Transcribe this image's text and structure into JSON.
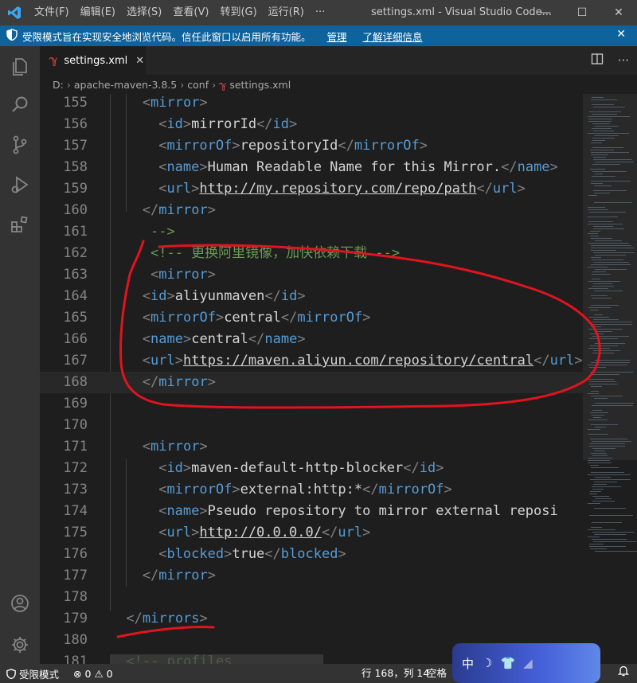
{
  "titlebar": {
    "menu": [
      "文件(F)",
      "编辑(E)",
      "选择(S)",
      "查看(V)",
      "转到(G)",
      "运行(R)",
      "···"
    ],
    "title": "settings.xml - Visual Studio Code...",
    "controls": {
      "minimize": "—",
      "maximize": "☐",
      "close": "✕"
    }
  },
  "banner": {
    "message": "受限模式旨在实现安全地浏览代码。信任此窗口以启用所有功能。",
    "manage": "管理",
    "learn_more": "了解详细信息",
    "close": "✕",
    "color": "#0e639c"
  },
  "tab": {
    "label": "settings.xml",
    "close": "✕",
    "icon": "xml-file-icon"
  },
  "breadcrumb": {
    "items": [
      "D:",
      "apache-maven-3.8.5",
      "conf",
      "settings.xml"
    ],
    "separator": "›"
  },
  "editor": {
    "lines": [
      {
        "n": "155",
        "indent": 4,
        "parts": [
          [
            "pun",
            "<"
          ],
          [
            "tag",
            "mirror"
          ],
          [
            "pun",
            ">"
          ]
        ]
      },
      {
        "n": "156",
        "indent": 6,
        "parts": [
          [
            "pun",
            "<"
          ],
          [
            "tag",
            "id"
          ],
          [
            "pun",
            ">"
          ],
          [
            "txt",
            "mirrorId"
          ],
          [
            "pun",
            "</"
          ],
          [
            "tag",
            "id"
          ],
          [
            "pun",
            ">"
          ]
        ]
      },
      {
        "n": "157",
        "indent": 6,
        "parts": [
          [
            "pun",
            "<"
          ],
          [
            "tag",
            "mirrorOf"
          ],
          [
            "pun",
            ">"
          ],
          [
            "txt",
            "repositoryId"
          ],
          [
            "pun",
            "</"
          ],
          [
            "tag",
            "mirrorOf"
          ],
          [
            "pun",
            ">"
          ]
        ]
      },
      {
        "n": "158",
        "indent": 6,
        "parts": [
          [
            "pun",
            "<"
          ],
          [
            "tag",
            "name"
          ],
          [
            "pun",
            ">"
          ],
          [
            "txt",
            "Human Readable Name for this Mirror."
          ],
          [
            "pun",
            "</"
          ],
          [
            "tag",
            "name"
          ],
          [
            "pun",
            ">"
          ]
        ]
      },
      {
        "n": "159",
        "indent": 6,
        "parts": [
          [
            "pun",
            "<"
          ],
          [
            "tag",
            "url"
          ],
          [
            "pun",
            ">"
          ],
          [
            "url",
            "http://my.repository.com/repo/path"
          ],
          [
            "pun",
            "</"
          ],
          [
            "tag",
            "url"
          ],
          [
            "pun",
            ">"
          ]
        ]
      },
      {
        "n": "160",
        "indent": 4,
        "parts": [
          [
            "pun",
            "</"
          ],
          [
            "tag",
            "mirror"
          ],
          [
            "pun",
            ">"
          ]
        ]
      },
      {
        "n": "161",
        "indent": 5,
        "parts": [
          [
            "cmt",
            "-->"
          ]
        ]
      },
      {
        "n": "162",
        "indent": 5,
        "parts": [
          [
            "cmt",
            "<!-- 更换阿里镜像，加快依赖下载 -->"
          ]
        ]
      },
      {
        "n": "163",
        "indent": 5,
        "parts": [
          [
            "pun",
            "<"
          ],
          [
            "tag",
            "mirror"
          ],
          [
            "pun",
            ">"
          ]
        ]
      },
      {
        "n": "164",
        "indent": 4,
        "parts": [
          [
            "pun",
            "<"
          ],
          [
            "tag",
            "id"
          ],
          [
            "pun",
            ">"
          ],
          [
            "txt",
            "aliyunmaven"
          ],
          [
            "pun",
            "</"
          ],
          [
            "tag",
            "id"
          ],
          [
            "pun",
            ">"
          ]
        ]
      },
      {
        "n": "165",
        "indent": 4,
        "parts": [
          [
            "pun",
            "<"
          ],
          [
            "tag",
            "mirrorOf"
          ],
          [
            "pun",
            ">"
          ],
          [
            "txt",
            "central"
          ],
          [
            "pun",
            "</"
          ],
          [
            "tag",
            "mirrorOf"
          ],
          [
            "pun",
            ">"
          ]
        ]
      },
      {
        "n": "166",
        "indent": 4,
        "parts": [
          [
            "pun",
            "<"
          ],
          [
            "tag",
            "name"
          ],
          [
            "pun",
            ">"
          ],
          [
            "txt",
            "central"
          ],
          [
            "pun",
            "</"
          ],
          [
            "tag",
            "name"
          ],
          [
            "pun",
            ">"
          ]
        ]
      },
      {
        "n": "167",
        "indent": 4,
        "parts": [
          [
            "pun",
            "<"
          ],
          [
            "tag",
            "url"
          ],
          [
            "pun",
            ">"
          ],
          [
            "url",
            "https://maven.aliyun.com/repository/central"
          ],
          [
            "pun",
            "</"
          ],
          [
            "tag",
            "url"
          ],
          [
            "pun",
            ">"
          ]
        ]
      },
      {
        "n": "168",
        "indent": 4,
        "parts": [
          [
            "pun",
            "</"
          ],
          [
            "tag",
            "mirror"
          ],
          [
            "pun",
            ">"
          ]
        ]
      },
      {
        "n": "169",
        "indent": 0,
        "parts": []
      },
      {
        "n": "170",
        "indent": 0,
        "parts": []
      },
      {
        "n": "171",
        "indent": 4,
        "parts": [
          [
            "pun",
            "<"
          ],
          [
            "tag",
            "mirror"
          ],
          [
            "pun",
            ">"
          ]
        ]
      },
      {
        "n": "172",
        "indent": 6,
        "parts": [
          [
            "pun",
            "<"
          ],
          [
            "tag",
            "id"
          ],
          [
            "pun",
            ">"
          ],
          [
            "txt",
            "maven-default-http-blocker"
          ],
          [
            "pun",
            "</"
          ],
          [
            "tag",
            "id"
          ],
          [
            "pun",
            ">"
          ]
        ]
      },
      {
        "n": "173",
        "indent": 6,
        "parts": [
          [
            "pun",
            "<"
          ],
          [
            "tag",
            "mirrorOf"
          ],
          [
            "pun",
            ">"
          ],
          [
            "txt",
            "external:http:*"
          ],
          [
            "pun",
            "</"
          ],
          [
            "tag",
            "mirrorOf"
          ],
          [
            "pun",
            ">"
          ]
        ]
      },
      {
        "n": "174",
        "indent": 6,
        "parts": [
          [
            "pun",
            "<"
          ],
          [
            "tag",
            "name"
          ],
          [
            "pun",
            ">"
          ],
          [
            "txt",
            "Pseudo repository to mirror external reposi"
          ]
        ]
      },
      {
        "n": "175",
        "indent": 6,
        "parts": [
          [
            "pun",
            "<"
          ],
          [
            "tag",
            "url"
          ],
          [
            "pun",
            ">"
          ],
          [
            "url",
            "http://0.0.0.0/"
          ],
          [
            "pun",
            "</"
          ],
          [
            "tag",
            "url"
          ],
          [
            "pun",
            ">"
          ]
        ]
      },
      {
        "n": "176",
        "indent": 6,
        "parts": [
          [
            "pun",
            "<"
          ],
          [
            "tag",
            "blocked"
          ],
          [
            "pun",
            ">"
          ],
          [
            "txt",
            "true"
          ],
          [
            "pun",
            "</"
          ],
          [
            "tag",
            "blocked"
          ],
          [
            "pun",
            ">"
          ]
        ]
      },
      {
        "n": "177",
        "indent": 4,
        "parts": [
          [
            "pun",
            "</"
          ],
          [
            "tag",
            "mirror"
          ],
          [
            "pun",
            ">"
          ]
        ]
      },
      {
        "n": "178",
        "indent": 0,
        "parts": []
      },
      {
        "n": "179",
        "indent": 2,
        "parts": [
          [
            "pun",
            "</"
          ],
          [
            "tag",
            "mirrors"
          ],
          [
            "pun",
            ">"
          ]
        ]
      },
      {
        "n": "180",
        "indent": 0,
        "parts": []
      },
      {
        "n": "181",
        "indent": 2,
        "parts": [
          [
            "cmt",
            "<!-- profiles"
          ]
        ]
      }
    ],
    "current_line": "168"
  },
  "statusbar": {
    "restricted": "受限模式",
    "errors": "0",
    "warnings": "0",
    "position": "行 168，列 14",
    "indent": "空格"
  },
  "ime": {
    "label": "中"
  },
  "colors": {
    "titlebar": "#3c3c3c",
    "activity": "#333333",
    "editor_bg": "#1e1e1e",
    "tag": "#569cd6",
    "comment": "#6a9955",
    "annotation": "#e0141e"
  }
}
